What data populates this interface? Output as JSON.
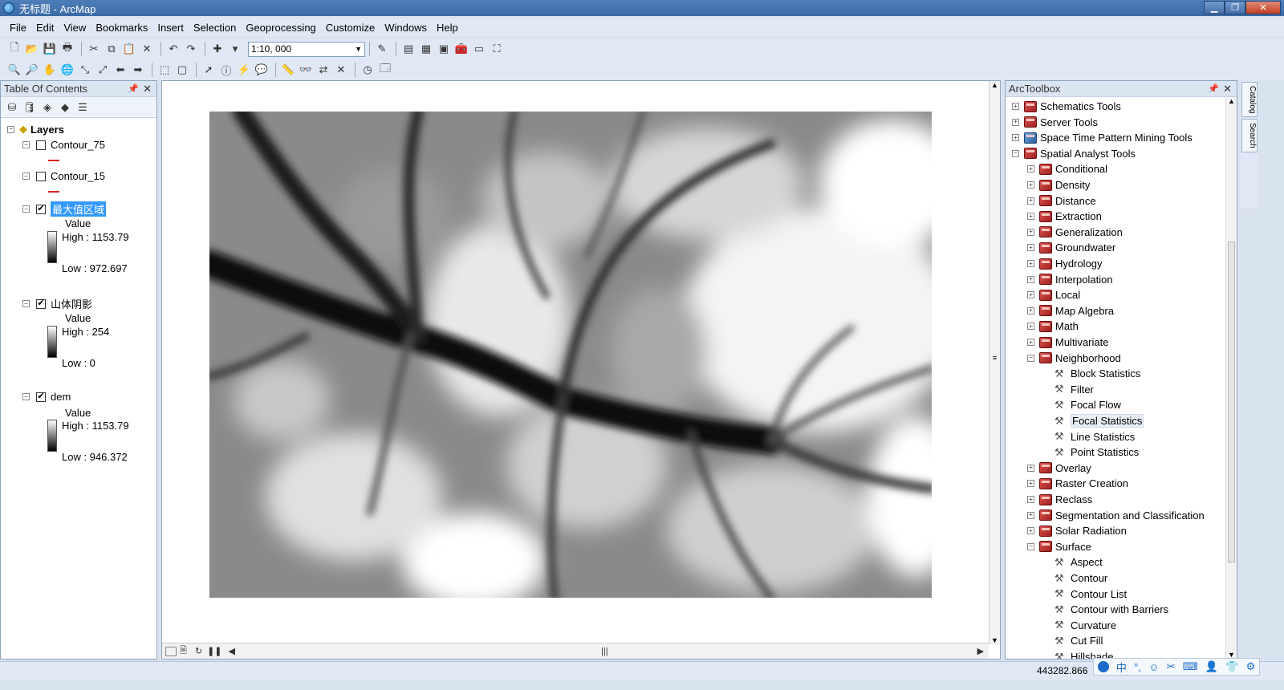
{
  "window": {
    "title": "无标题 - ArcMap"
  },
  "menu": [
    "File",
    "Edit",
    "View",
    "Bookmarks",
    "Insert",
    "Selection",
    "Geoprocessing",
    "Customize",
    "Windows",
    "Help"
  ],
  "toolbar": {
    "scale": "1:10, 000"
  },
  "toc": {
    "title": "Table Of Contents",
    "root": "Layers",
    "layers": [
      {
        "name": "Contour_75",
        "checked": false
      },
      {
        "name": "Contour_15",
        "checked": false
      },
      {
        "name": "最大值区域",
        "checked": true,
        "selected": true,
        "field": "Value",
        "high": "High : 1153.79",
        "low": "Low : 972.697"
      },
      {
        "name": "山体阴影",
        "checked": true,
        "field": "Value",
        "high": "High : 254",
        "low": "Low : 0"
      },
      {
        "name": "dem",
        "checked": true,
        "field": "Value",
        "high": "High : 1153.79",
        "low": "Low : 946.372"
      }
    ]
  },
  "toolbox": {
    "title": "ArcToolbox",
    "items": [
      {
        "label": "Schematics Tools",
        "level": 0,
        "type": "toolbox",
        "expanded": false
      },
      {
        "label": "Server Tools",
        "level": 0,
        "type": "toolbox",
        "expanded": false
      },
      {
        "label": "Space Time Pattern Mining Tools",
        "level": 0,
        "type": "toolbox-blue",
        "expanded": false
      },
      {
        "label": "Spatial Analyst Tools",
        "level": 0,
        "type": "toolbox",
        "expanded": true
      },
      {
        "label": "Conditional",
        "level": 1,
        "type": "toolset",
        "expanded": false
      },
      {
        "label": "Density",
        "level": 1,
        "type": "toolset",
        "expanded": false
      },
      {
        "label": "Distance",
        "level": 1,
        "type": "toolset",
        "expanded": false
      },
      {
        "label": "Extraction",
        "level": 1,
        "type": "toolset",
        "expanded": false
      },
      {
        "label": "Generalization",
        "level": 1,
        "type": "toolset",
        "expanded": false
      },
      {
        "label": "Groundwater",
        "level": 1,
        "type": "toolset",
        "expanded": false
      },
      {
        "label": "Hydrology",
        "level": 1,
        "type": "toolset",
        "expanded": false
      },
      {
        "label": "Interpolation",
        "level": 1,
        "type": "toolset",
        "expanded": false
      },
      {
        "label": "Local",
        "level": 1,
        "type": "toolset",
        "expanded": false
      },
      {
        "label": "Map Algebra",
        "level": 1,
        "type": "toolset",
        "expanded": false
      },
      {
        "label": "Math",
        "level": 1,
        "type": "toolset",
        "expanded": false
      },
      {
        "label": "Multivariate",
        "level": 1,
        "type": "toolset",
        "expanded": false
      },
      {
        "label": "Neighborhood",
        "level": 1,
        "type": "toolset",
        "expanded": true
      },
      {
        "label": "Block Statistics",
        "level": 2,
        "type": "tool"
      },
      {
        "label": "Filter",
        "level": 2,
        "type": "tool"
      },
      {
        "label": "Focal Flow",
        "level": 2,
        "type": "tool"
      },
      {
        "label": "Focal Statistics",
        "level": 2,
        "type": "tool",
        "highlight": true
      },
      {
        "label": "Line Statistics",
        "level": 2,
        "type": "tool"
      },
      {
        "label": "Point Statistics",
        "level": 2,
        "type": "tool"
      },
      {
        "label": "Overlay",
        "level": 1,
        "type": "toolset",
        "expanded": false
      },
      {
        "label": "Raster Creation",
        "level": 1,
        "type": "toolset",
        "expanded": false
      },
      {
        "label": "Reclass",
        "level": 1,
        "type": "toolset",
        "expanded": false
      },
      {
        "label": "Segmentation and Classification",
        "level": 1,
        "type": "toolset",
        "expanded": false
      },
      {
        "label": "Solar Radiation",
        "level": 1,
        "type": "toolset",
        "expanded": false
      },
      {
        "label": "Surface",
        "level": 1,
        "type": "toolset",
        "expanded": true
      },
      {
        "label": "Aspect",
        "level": 2,
        "type": "tool"
      },
      {
        "label": "Contour",
        "level": 2,
        "type": "tool"
      },
      {
        "label": "Contour List",
        "level": 2,
        "type": "tool"
      },
      {
        "label": "Contour with Barriers",
        "level": 2,
        "type": "tool"
      },
      {
        "label": "Curvature",
        "level": 2,
        "type": "tool"
      },
      {
        "label": "Cut Fill",
        "level": 2,
        "type": "tool"
      },
      {
        "label": "Hillshade",
        "level": 2,
        "type": "tool"
      }
    ]
  },
  "sidetabs": [
    "Catalog",
    "Search"
  ],
  "status": {
    "coord": "443282.866"
  },
  "ime": [
    "中",
    "°,",
    "☺",
    "✂",
    "⌨",
    "👤",
    "👕",
    "⚙"
  ]
}
